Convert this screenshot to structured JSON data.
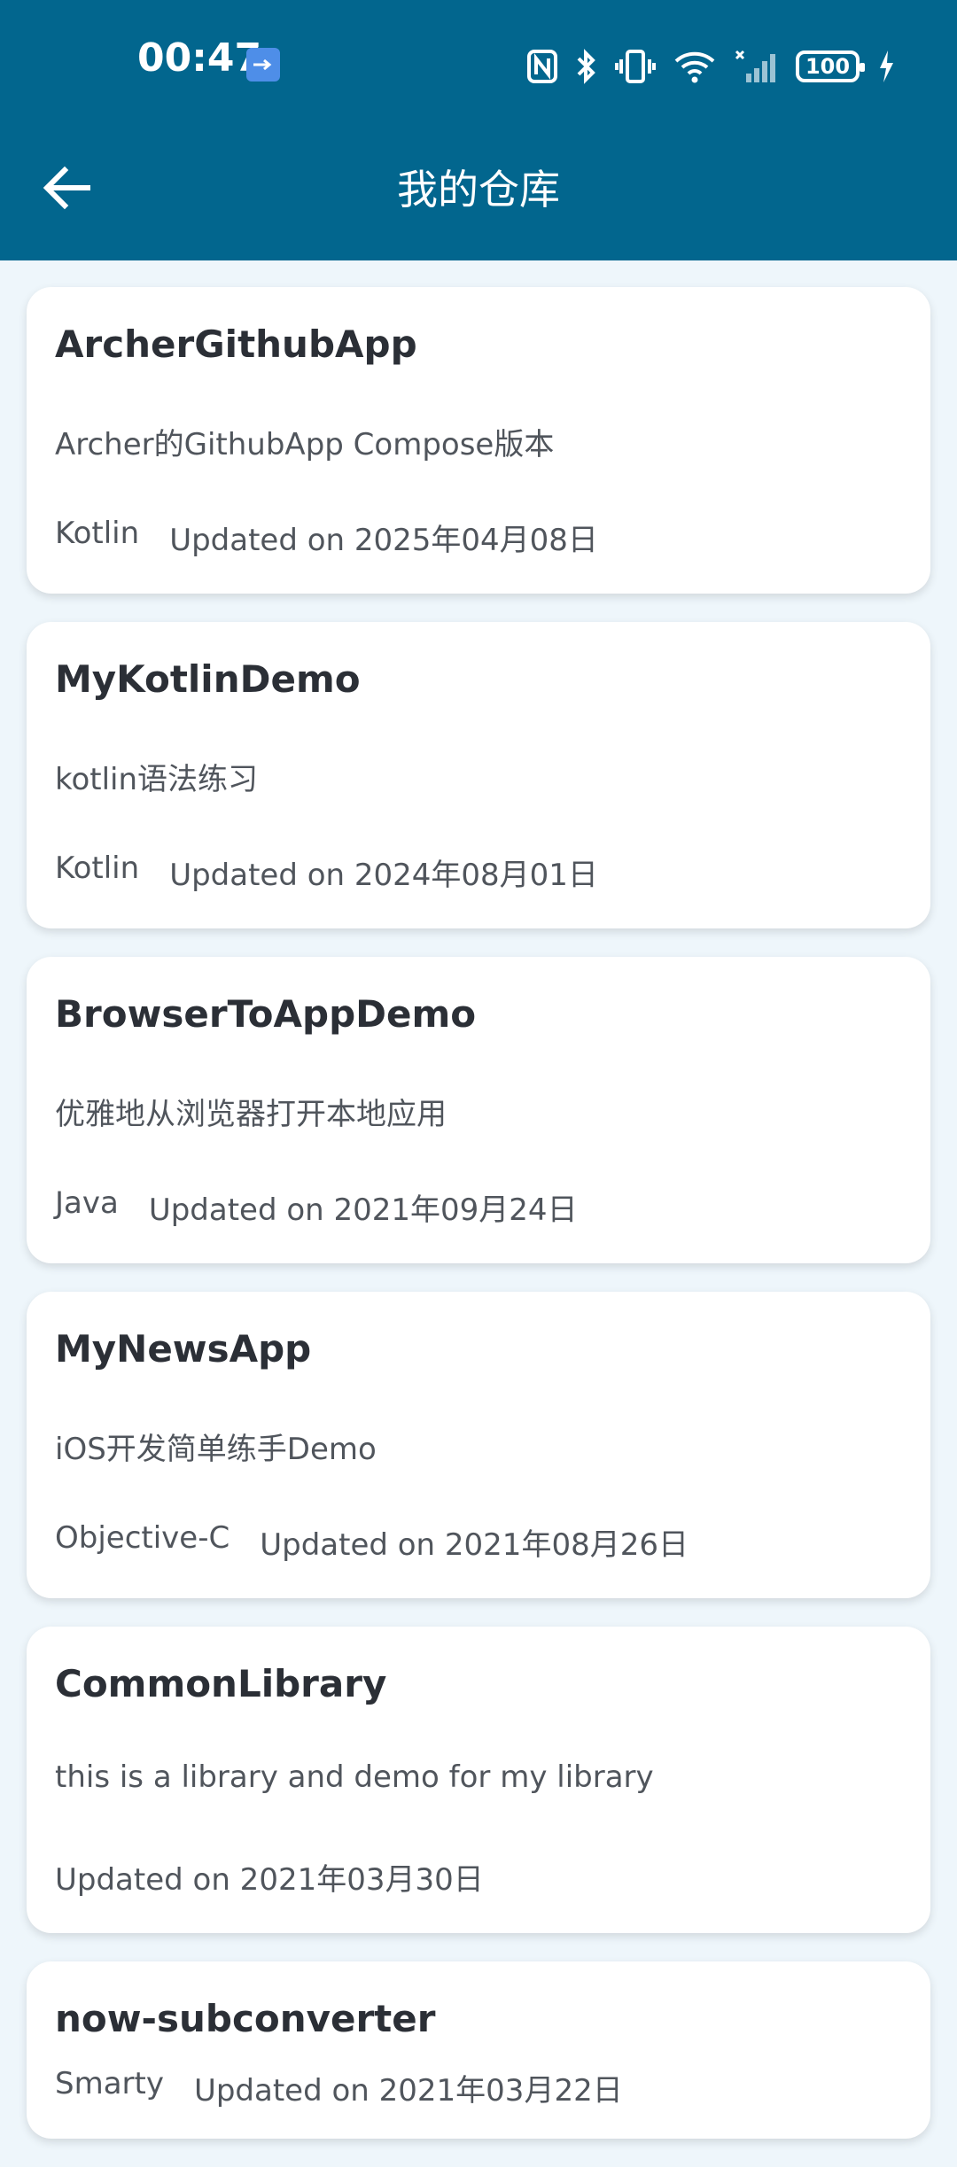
{
  "status_bar": {
    "time": "00:47",
    "battery": "100",
    "icons": [
      "usb-icon",
      "nfc-icon",
      "bluetooth-icon",
      "vibrate-icon",
      "wifi-icon",
      "signal-icon",
      "battery-icon",
      "charging-icon"
    ]
  },
  "header": {
    "title": "我的仓库",
    "back_icon": "arrow-left-icon",
    "color": "#02668e"
  },
  "repos": [
    {
      "name": "ArcherGithubApp",
      "description": "Archer的GithubApp Compose版本",
      "language": "Kotlin",
      "updated": "Updated on 2025年04月08日"
    },
    {
      "name": "MyKotlinDemo",
      "description": "kotlin语法练习",
      "language": "Kotlin",
      "updated": "Updated on 2024年08月01日"
    },
    {
      "name": "BrowserToAppDemo",
      "description": "优雅地从浏览器打开本地应用",
      "language": "Java",
      "updated": "Updated on 2021年09月24日"
    },
    {
      "name": "MyNewsApp",
      "description": "iOS开发简单练手Demo",
      "language": "Objective-C",
      "updated": "Updated on 2021年08月26日"
    },
    {
      "name": "CommonLibrary",
      "description": "this is a library and demo for my library",
      "language": "",
      "updated": "Updated on 2021年03月30日"
    },
    {
      "name": "now-subconverter",
      "description": "",
      "language": "Smarty",
      "updated": "Updated on 2021年03月22日"
    }
  ]
}
